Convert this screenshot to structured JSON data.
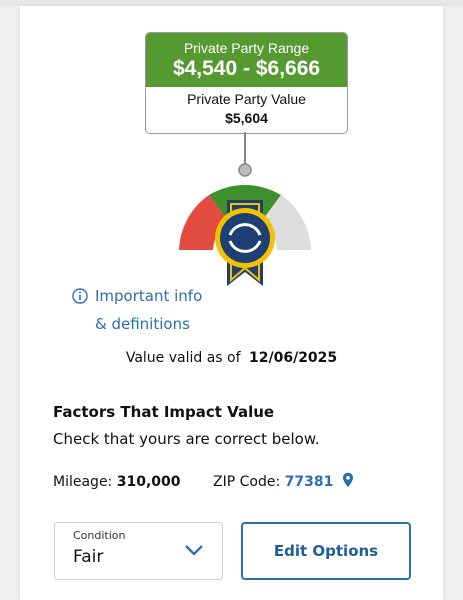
{
  "price_box": {
    "range_label": "Private Party Range",
    "range_value": "$4,540 - $6,666",
    "value_label": "Private Party Value",
    "value_amount": "$5,604"
  },
  "colors": {
    "range_header": "#559a30",
    "gauge_low": "#e24b3f",
    "gauge_mid": "#3f8f2b",
    "gauge_high": "#dddddd",
    "badge_navy": "#1d3f74",
    "badge_gold": "#f2c200",
    "link_blue": "#2a6fb0"
  },
  "info": {
    "icon": "info-circle-icon",
    "label_line1": "Important info",
    "label_line2": "& definitions"
  },
  "validity": {
    "label": "Value valid as of",
    "date": "12/06/2025"
  },
  "factors": {
    "title": "Factors That Impact Value",
    "subtitle": "Check that yours are correct below."
  },
  "details": {
    "mileage_label": "Mileage:",
    "mileage_value": "310,000",
    "zip_label": "ZIP Code:",
    "zip_value": "77381",
    "zip_icon": "location-pin-icon"
  },
  "condition": {
    "label": "Condition",
    "value": "Fair",
    "icon": "chevron-down-icon"
  },
  "actions": {
    "edit_options_label": "Edit Options"
  }
}
